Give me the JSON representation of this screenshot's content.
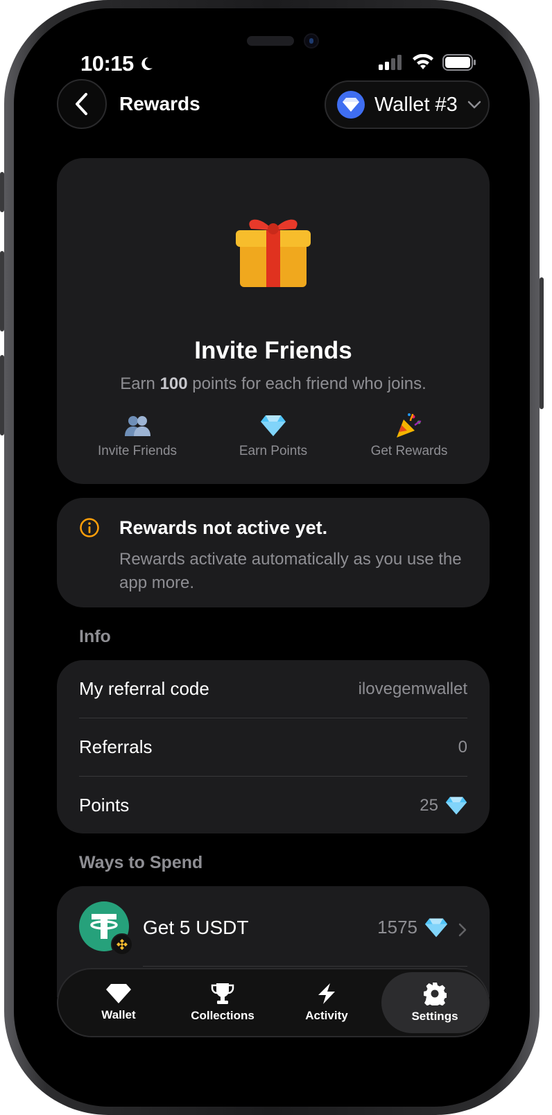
{
  "status_bar": {
    "time": "10:15"
  },
  "header": {
    "title": "Rewards",
    "wallet_name": "Wallet #3"
  },
  "invite": {
    "title": "Invite Friends",
    "subtitle_pre": "Earn ",
    "subtitle_points": "100",
    "subtitle_post": " points for each friend who joins.",
    "steps": [
      {
        "label": "Invite Friends",
        "icon": "people-icon"
      },
      {
        "label": "Earn Points",
        "icon": "gem-icon"
      },
      {
        "label": "Get Rewards",
        "icon": "party-popper-icon"
      }
    ]
  },
  "notice": {
    "title": "Rewards not active yet.",
    "body": "Rewards activate automatically as you use the app more.",
    "accent": "#ff9f0a"
  },
  "info": {
    "section_label": "Info",
    "rows": [
      {
        "key": "My referral code",
        "value": "ilovegemwallet"
      },
      {
        "key": "Referrals",
        "value": "0"
      },
      {
        "key": "Points",
        "value": "25"
      }
    ]
  },
  "spend": {
    "section_label": "Ways to Spend",
    "items": [
      {
        "title": "Get 5 USDT",
        "price": "1575"
      }
    ]
  },
  "tabbar": {
    "tabs": [
      {
        "label": "Wallet",
        "icon": "gem-icon"
      },
      {
        "label": "Collections",
        "icon": "trophy-icon"
      },
      {
        "label": "Activity",
        "icon": "lightning-icon"
      },
      {
        "label": "Settings",
        "icon": "gear-icon",
        "active": true
      }
    ]
  },
  "colors": {
    "background": "#000000",
    "card": "#1c1c1e",
    "secondary_text": "#8e8e93",
    "wallet_blue": "#3f6ef1",
    "usdt_green": "#26a17b"
  }
}
